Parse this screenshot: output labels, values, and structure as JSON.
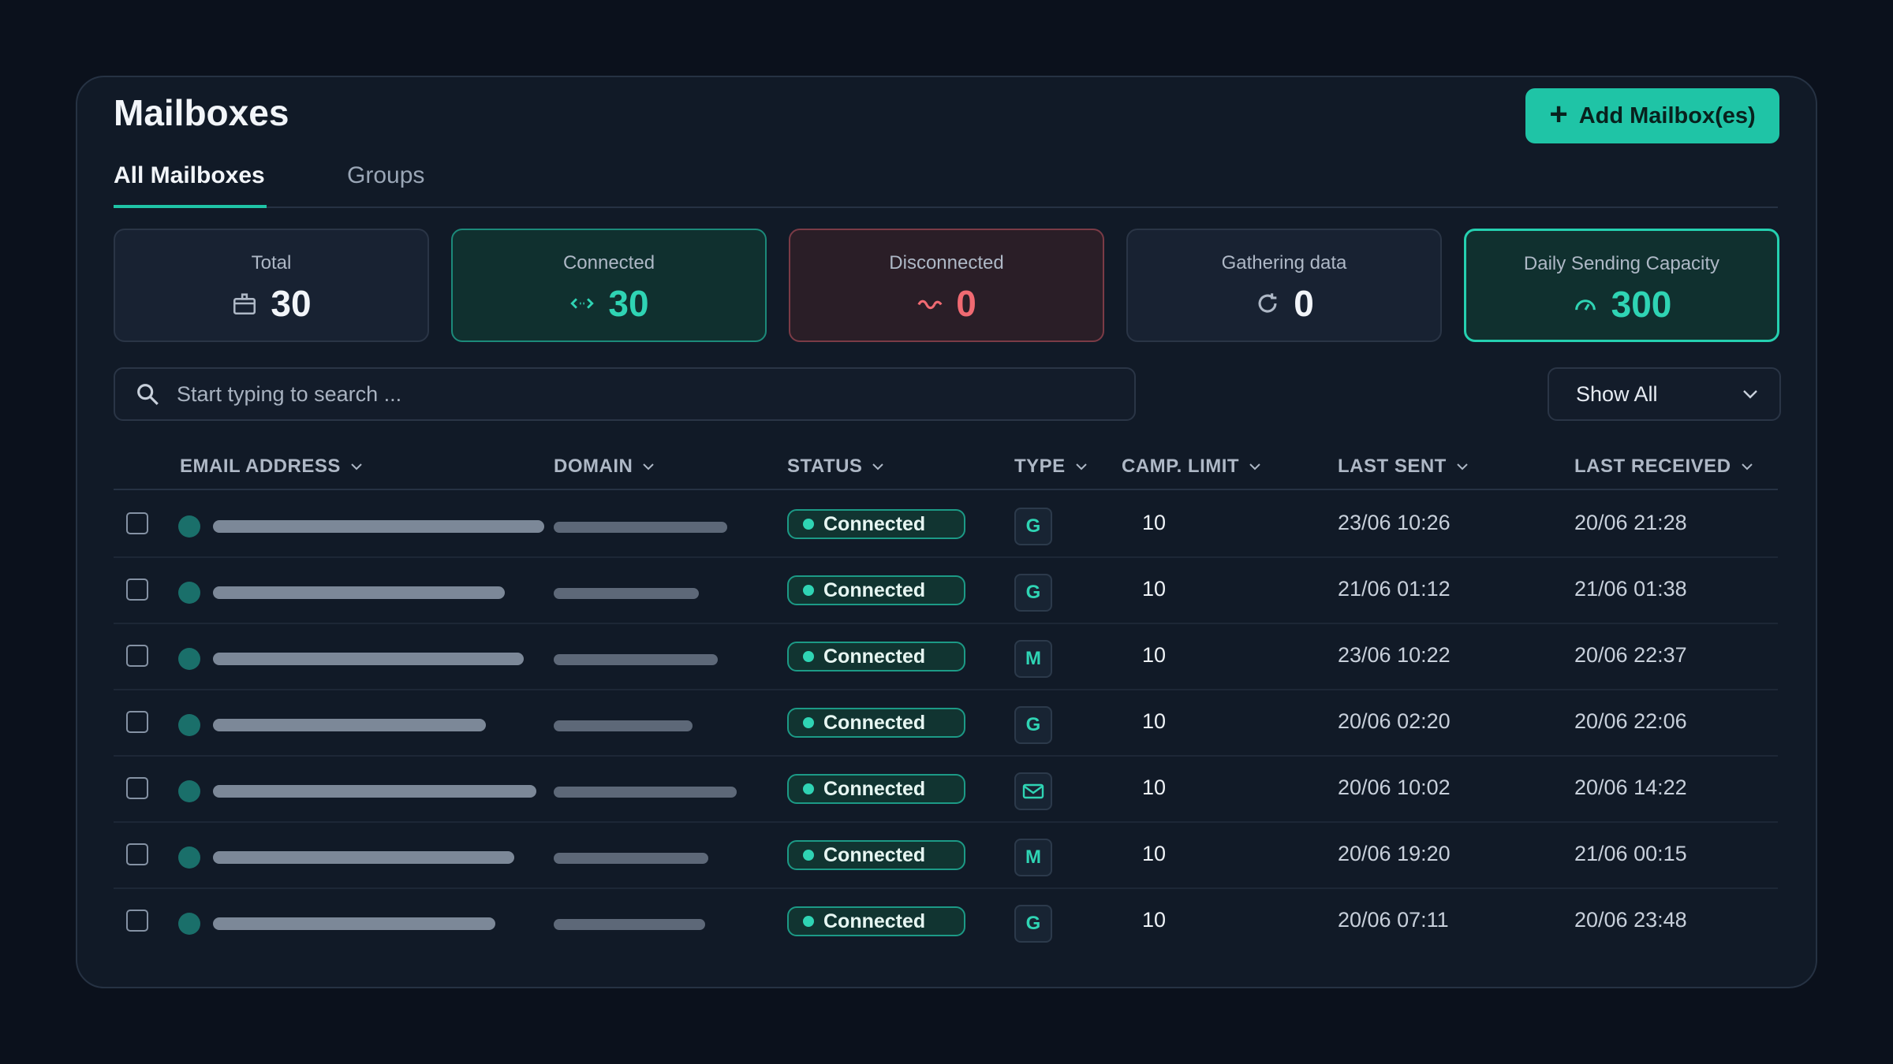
{
  "header": {
    "title": "Mailboxes",
    "add_button_label": "Add Mailbox(es)"
  },
  "tabs": [
    {
      "label": "All Mailboxes",
      "active": true
    },
    {
      "label": "Groups",
      "active": false
    }
  ],
  "stats": [
    {
      "label": "Total",
      "value": "30",
      "icon": "mailbox-icon"
    },
    {
      "label": "Connected",
      "value": "30",
      "icon": "link-icon"
    },
    {
      "label": "Disconnected",
      "value": "0",
      "icon": "broken-link-icon"
    },
    {
      "label": "Gathering data",
      "value": "0",
      "icon": "refresh-icon"
    },
    {
      "label": "Daily Sending Capacity",
      "value": "300",
      "icon": "gauge-icon"
    }
  ],
  "search": {
    "placeholder": "Start typing to search ..."
  },
  "filter": {
    "selected": "Show All"
  },
  "columns": [
    "EMAIL ADDRESS",
    "DOMAIN",
    "STATUS",
    "TYPE",
    "CAMP. LIMIT",
    "LAST SENT",
    "LAST RECEIVED"
  ],
  "rows": [
    {
      "status": "Connected",
      "type": "G",
      "limit": "10",
      "last_sent": "23/06 10:26",
      "last_received": "20/06 21:28"
    },
    {
      "status": "Connected",
      "type": "G",
      "limit": "10",
      "last_sent": "21/06 01:12",
      "last_received": "21/06 01:38"
    },
    {
      "status": "Connected",
      "type": "M",
      "limit": "10",
      "last_sent": "23/06 10:22",
      "last_received": "20/06 22:37"
    },
    {
      "status": "Connected",
      "type": "G",
      "limit": "10",
      "last_sent": "20/06 02:20",
      "last_received": "20/06 22:06"
    },
    {
      "status": "Connected",
      "type": "",
      "type_icon": "envelope-icon",
      "limit": "10",
      "last_sent": "20/06 10:02",
      "last_received": "20/06 14:22"
    },
    {
      "status": "Connected",
      "type": "M",
      "limit": "10",
      "last_sent": "20/06 19:20",
      "last_received": "21/06 00:15"
    },
    {
      "status": "Connected",
      "type": "G",
      "limit": "10",
      "last_sent": "20/06 07:11",
      "last_received": "20/06 23:48"
    }
  ],
  "colors": {
    "accent": "#1fc4a6",
    "connected": "#2fd4b4",
    "disconnected": "#f06a72",
    "background": "#0b111c",
    "panel": "#111a27"
  }
}
